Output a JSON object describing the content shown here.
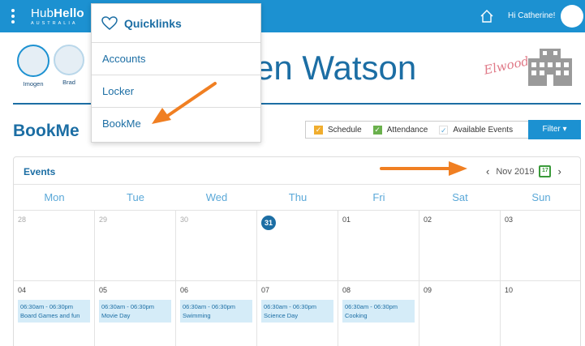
{
  "header": {
    "brand_main": "Hub",
    "brand_bold": "Hello",
    "brand_sub": "AUSTRALIA",
    "greeting": "Hi Catherine!",
    "color": "#1c91d1"
  },
  "profiles": [
    {
      "name": "Imogen",
      "active": true
    },
    {
      "name": "Brad",
      "active": false
    }
  ],
  "child_name_visible": "en Watson",
  "brand_script": "Elwood",
  "page": {
    "title": "BookMe",
    "legend": [
      {
        "label": "Schedule",
        "color": "#f0ad2e"
      },
      {
        "label": "Attendance",
        "color": "#6ab04c"
      },
      {
        "label": "Available Events",
        "color": "#5aa8d8"
      }
    ],
    "filter_label": "Filter ▾"
  },
  "calendar": {
    "label": "Events",
    "month": "Nov 2019",
    "prev": "‹",
    "next": "›",
    "weekdays": [
      "Mon",
      "Tue",
      "Wed",
      "Thu",
      "Fri",
      "Sat",
      "Sun"
    ],
    "days": [
      {
        "n": "28",
        "other": true
      },
      {
        "n": "29",
        "other": true
      },
      {
        "n": "30",
        "other": true
      },
      {
        "n": "31",
        "today": true
      },
      {
        "n": "01"
      },
      {
        "n": "02"
      },
      {
        "n": "03"
      },
      {
        "n": "04",
        "event": {
          "time": "06:30am - 06:30pm",
          "title": "Board Games and fun"
        }
      },
      {
        "n": "05",
        "event": {
          "time": "06:30am - 06:30pm",
          "title": "Movie Day"
        }
      },
      {
        "n": "06",
        "event": {
          "time": "06:30am - 06:30pm",
          "title": "Swimming"
        }
      },
      {
        "n": "07",
        "event": {
          "time": "06:30am - 06:30pm",
          "title": "Science Day"
        }
      },
      {
        "n": "08",
        "event": {
          "time": "06:30am - 06:30pm",
          "title": "Cooking"
        }
      },
      {
        "n": "09"
      },
      {
        "n": "10"
      }
    ]
  },
  "dropdown": {
    "heading": "Quicklinks",
    "items": [
      "Accounts",
      "Locker",
      "BookMe"
    ]
  },
  "annotation_color": "#f07f22"
}
